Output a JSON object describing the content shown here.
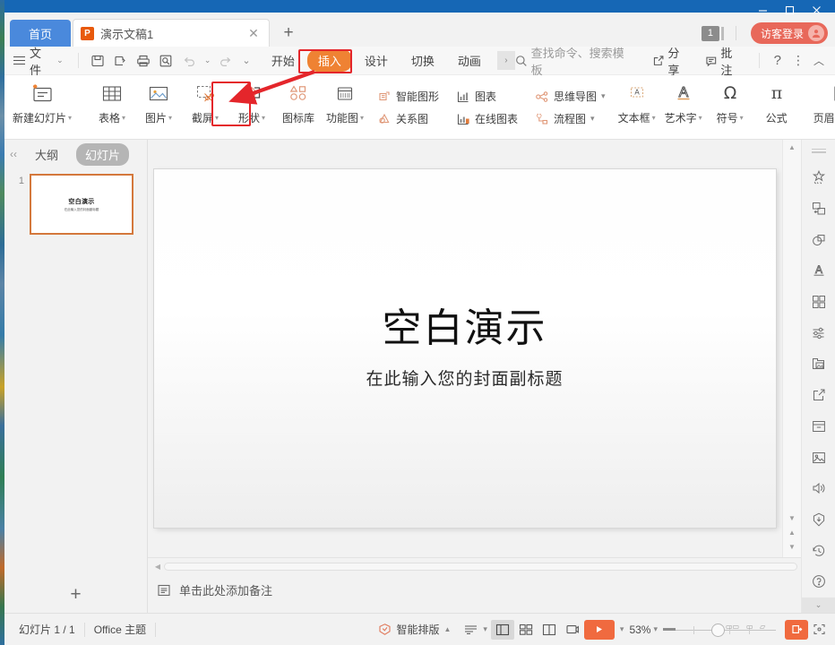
{
  "app": {
    "window_controls": [
      "minimize",
      "maximize",
      "close"
    ]
  },
  "tabbar": {
    "home_label": "首页",
    "doc_tab": {
      "icon": "P",
      "title": "演示文稿1",
      "close": "✕"
    },
    "new_tab": "+",
    "page_badge": "1",
    "login_label": "访客登录"
  },
  "menubar": {
    "file_label": "文件",
    "caret": "⌄",
    "quick_access": [
      "save-icon",
      "save-as-icon",
      "print-icon",
      "print-preview-icon",
      "undo-icon",
      "redo-icon",
      "customize-icon"
    ],
    "tabs": [
      {
        "label": "开始",
        "active": false
      },
      {
        "label": "插入",
        "active": true
      },
      {
        "label": "设计",
        "active": false
      },
      {
        "label": "切换",
        "active": false
      },
      {
        "label": "动画",
        "active": false
      }
    ],
    "more_tabs": "›",
    "search_placeholder": "查找命令、搜索模板",
    "share_label": "分享",
    "comment_label": "批注",
    "help_label": "?",
    "more_label": "⋮",
    "collapse_label": "︿"
  },
  "ribbon": {
    "new_slide": {
      "label": "新建幻灯片",
      "has_caret": true
    },
    "items": [
      {
        "label": "表格",
        "icon": "table-icon",
        "has_caret": true
      },
      {
        "label": "图片",
        "icon": "picture-icon",
        "has_caret": true
      },
      {
        "label": "截屏",
        "icon": "screenshot-icon",
        "has_caret": true
      },
      {
        "label": "形状",
        "icon": "shapes-icon",
        "has_caret": true,
        "highlighted": true
      },
      {
        "label": "图标库",
        "icon": "icon-library-icon",
        "has_caret": false
      },
      {
        "label": "功能图",
        "icon": "function-chart-icon",
        "has_caret": true
      }
    ],
    "stack1": [
      {
        "label": "智能图形",
        "icon": "smart-art-icon"
      },
      {
        "label": "关系图",
        "icon": "relationship-diagram-icon"
      }
    ],
    "stack2": [
      {
        "label": "图表",
        "icon": "chart-icon"
      },
      {
        "label": "在线图表",
        "icon": "online-chart-icon"
      }
    ],
    "stack3": [
      {
        "label": "思维导图",
        "icon": "mind-map-icon",
        "has_caret": true
      },
      {
        "label": "流程图",
        "icon": "flow-chart-icon",
        "has_caret": true
      }
    ],
    "text_group": [
      {
        "label": "文本框",
        "icon": "text-box-icon",
        "has_caret": true
      },
      {
        "label": "艺术字",
        "icon": "word-art-icon",
        "has_caret": true
      },
      {
        "label": "符号",
        "icon": "symbol-icon",
        "has_caret": true
      },
      {
        "label": "公式",
        "icon": "formula-icon",
        "has_caret": false
      }
    ],
    "header_footer": {
      "label": "页眉和页脚",
      "icon": "header-footer-icon"
    }
  },
  "slide_panel": {
    "collapse": "‹‹",
    "tabs": [
      {
        "label": "大纲",
        "active": false
      },
      {
        "label": "幻灯片",
        "active": true
      }
    ],
    "thumbnails": [
      {
        "number": "1",
        "title": "空白演示",
        "subtitle": "在此输入您的封面副标题"
      }
    ],
    "add_slide": "+"
  },
  "slide": {
    "title": "空白演示",
    "subtitle": "在此输入您的封面副标题"
  },
  "notes": {
    "placeholder": "单击此处添加备注",
    "icon": "notes-icon"
  },
  "right_rail": {
    "icons": [
      "magic-wand-icon",
      "duplicate-shape-icon",
      "shape-combine-icon",
      "word-art-style-icon",
      "grid-apps-icon",
      "settings-sliders-icon",
      "image-library-icon",
      "share-export-icon",
      "archive-box-icon",
      "picture-insert-icon",
      "sound-icon",
      "badge-icon",
      "history-icon",
      "help-circle-icon"
    ],
    "collapse": "⌄"
  },
  "statusbar": {
    "slide_count": "幻灯片 1 / 1",
    "theme": "Office 主题",
    "smart_layout": "智能排版",
    "smart_layout_caret": "▲",
    "outline_view": "outline-view-icon",
    "view_buttons": [
      "normal-view-icon",
      "slide-sorter-icon",
      "reading-view-icon",
      "presenter-view-icon"
    ],
    "play_label": "▶",
    "play_caret": "▾",
    "zoom_level": "53%",
    "zoom_caret": "▾",
    "fit_label": "fit-to-window-icon"
  },
  "annotations": {
    "highlight_color": "#e4262b",
    "boxes": [
      {
        "target": "insert-tab"
      },
      {
        "target": "shapes-button"
      }
    ],
    "arrow": {
      "from": "insert-tab",
      "to": "shapes-button"
    }
  }
}
